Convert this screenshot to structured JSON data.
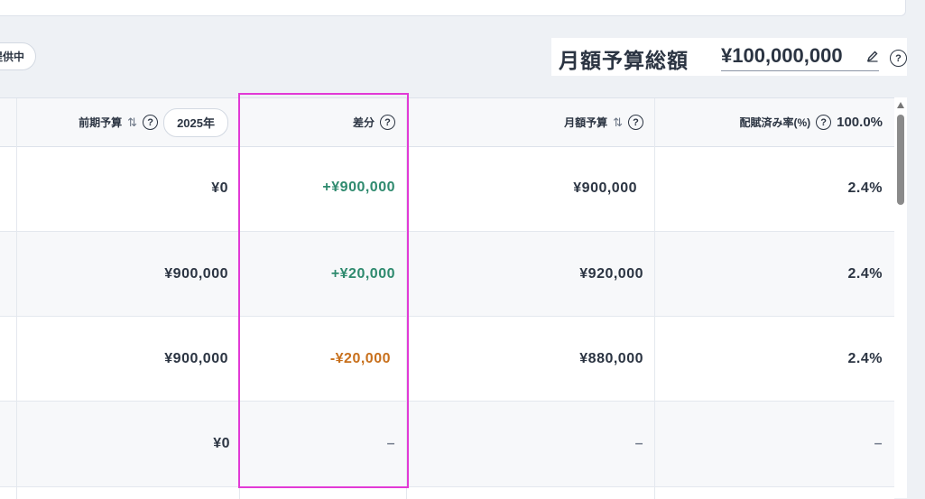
{
  "status_pill": {
    "label": "提供中"
  },
  "budget": {
    "label": "月額予算総額",
    "value": "¥100,000,000"
  },
  "table": {
    "headers": {
      "prev_budget": "前期予算",
      "year": "2025年",
      "diff": "差分",
      "monthly": "月額予算",
      "rate": "配賦済み率(%)",
      "rate_total": "100.0%"
    },
    "rows": [
      {
        "prev": "¥0",
        "diff": "+¥900,000",
        "monthly": "¥900,000",
        "rate": "2.4%"
      },
      {
        "prev": "¥900,000",
        "diff": "+¥20,000",
        "monthly": "¥920,000",
        "rate": "2.4%"
      },
      {
        "prev": "¥900,000",
        "diff": "-¥20,000",
        "monthly": "¥880,000",
        "rate": "2.4%"
      },
      {
        "prev": "¥0",
        "diff": "–",
        "monthly": "–",
        "rate": "–"
      }
    ]
  },
  "icons": {
    "help": "?",
    "sort": "⇅"
  },
  "colors": {
    "positive": "#2e8a6e",
    "negative": "#c8701c",
    "highlight": "#e23ad6"
  }
}
